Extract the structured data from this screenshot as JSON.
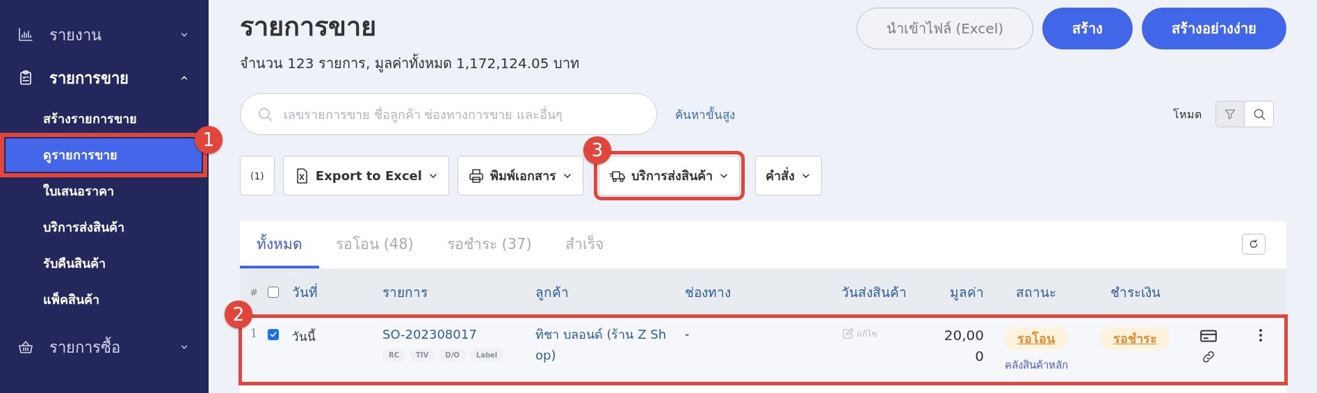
{
  "sidebar": {
    "items": [
      {
        "label": "รายงาน",
        "expanded": false
      },
      {
        "label": "รายการขาย",
        "expanded": true,
        "children": [
          {
            "label": "สร้างรายการขาย",
            "selected": false
          },
          {
            "label": "ดูรายการขาย",
            "selected": true,
            "marker": "1"
          },
          {
            "label": "ใบเสนอราคา",
            "selected": false
          },
          {
            "label": "บริการส่งสินค้า",
            "selected": false
          },
          {
            "label": "รับคืนสินค้า",
            "selected": false
          },
          {
            "label": "แพ็คสินค้า",
            "selected": false
          }
        ]
      },
      {
        "label": "รายการซื้อ",
        "expanded": false
      }
    ]
  },
  "page": {
    "title": "รายการขาย",
    "summary": "จำนวน 123 รายการ, มูลค่าทั้งหมด 1,172,124.05 บาท",
    "buttons": [
      {
        "label": "นำเข้าไฟล์ (Excel)",
        "kind": "outline"
      },
      {
        "label": "สร้าง",
        "kind": "primary"
      },
      {
        "label": "สร้างอย่างง่าย",
        "kind": "primary"
      }
    ]
  },
  "search": {
    "placeholder": "เลขรายการขาย ชื่อลูกค้า ช่องทางการขาย และอื่นๆ",
    "advanced_link": "ค้นหาขั้นสูง"
  },
  "mode": {
    "label": "โหมด",
    "options": [
      {
        "selected": true
      },
      {
        "selected": false
      }
    ]
  },
  "toolbar": {
    "buttons": [
      {
        "label": "(1)",
        "dropdown": false
      },
      {
        "label": "Export to Excel",
        "dropdown": true
      },
      {
        "label": "พิมพ์เอกสาร",
        "dropdown": true
      },
      {
        "label": "บริการส่งสินค้า",
        "dropdown": true,
        "marker": "3"
      },
      {
        "label": "คำสั่ง",
        "dropdown": true
      }
    ]
  },
  "tabs": [
    {
      "label": "ทั้งหมด",
      "selected": true
    },
    {
      "label": "รอโอน (48)",
      "selected": false
    },
    {
      "label": "รอชำระ (37)",
      "selected": false
    },
    {
      "label": "สำเร็จ",
      "selected": false
    }
  ],
  "table": {
    "header_checked": false,
    "columns": [
      "#",
      "วันที่",
      "รายการ",
      "ลูกค้า",
      "ช่องทาง",
      "วันส่งสินค้า",
      "มูลค่า",
      "สถานะ",
      "ชำระเงิน"
    ],
    "rows": [
      {
        "number": "1",
        "checked": true,
        "date": "วันนี้",
        "order": "SO-202308017",
        "tags": [
          "RC",
          "TIV",
          "D/O",
          "Label"
        ],
        "customer": "ทิชา บลอนด์ (ร้าน Z Shop)",
        "channel": "-",
        "ship_date": "แก้ไข",
        "value": "20,000",
        "status": "รอโอน",
        "warehouse": "คลังสินค้าหลัก",
        "payment": "รอชำระ",
        "marker": "2"
      }
    ]
  }
}
